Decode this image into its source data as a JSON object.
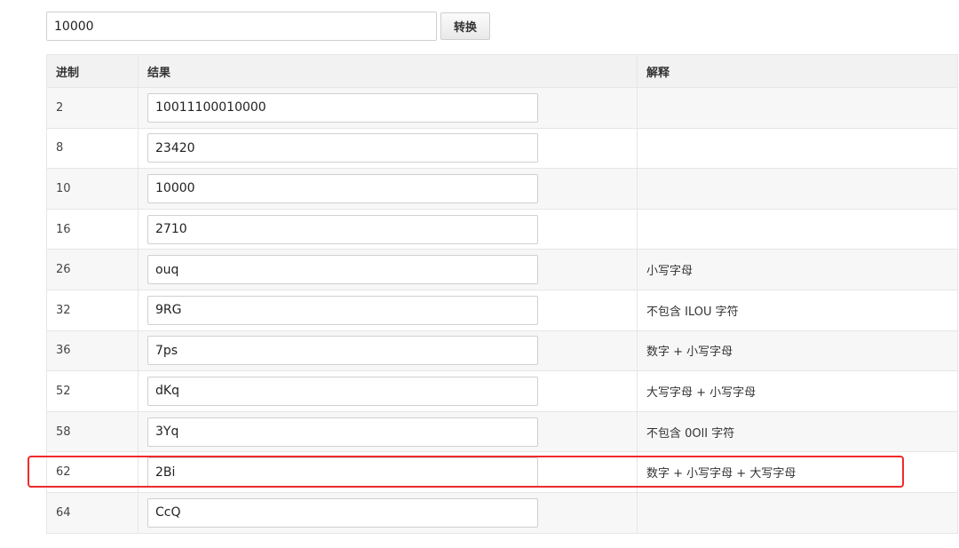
{
  "converter": {
    "input_value": "10000",
    "convert_label": "转换"
  },
  "table": {
    "headers": {
      "base": "进制",
      "result": "结果",
      "note": "解释"
    },
    "rows": [
      {
        "base": "2",
        "result": "10011100010000",
        "note": ""
      },
      {
        "base": "8",
        "result": "23420",
        "note": ""
      },
      {
        "base": "10",
        "result": "10000",
        "note": ""
      },
      {
        "base": "16",
        "result": "2710",
        "note": ""
      },
      {
        "base": "26",
        "result": "ouq",
        "note": "小写字母"
      },
      {
        "base": "32",
        "result": "9RG",
        "note": "不包含 ILOU 字符"
      },
      {
        "base": "36",
        "result": "7ps",
        "note": "数字 + 小写字母"
      },
      {
        "base": "52",
        "result": "dKq",
        "note": "大写字母 + 小写字母"
      },
      {
        "base": "58",
        "result": "3Yq",
        "note": "不包含 0OlI 字符"
      },
      {
        "base": "62",
        "result": "2Bi",
        "note": "数字 + 小写字母 + 大写字母"
      },
      {
        "base": "64",
        "result": "CcQ",
        "note": ""
      }
    ]
  },
  "highlight": {
    "row_base": "62",
    "color": "#ee2b2b"
  }
}
